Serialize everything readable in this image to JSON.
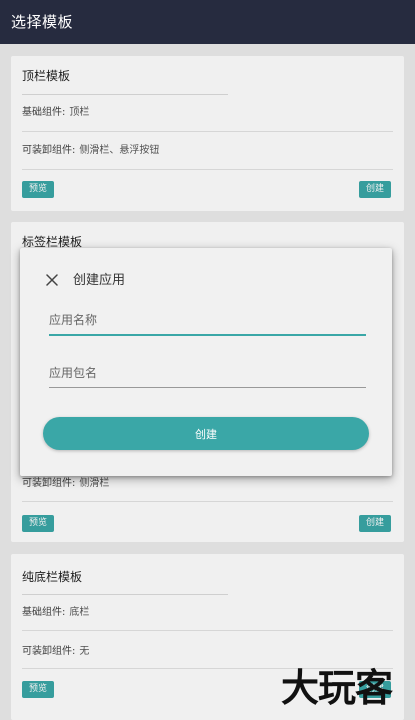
{
  "appbar": {
    "title": "选择模板"
  },
  "cards": [
    {
      "title": "顶栏模板",
      "rows": [
        {
          "label": "基础组件:",
          "value": "顶栏"
        },
        {
          "label": "可装卸组件:",
          "value": "侧滑栏、悬浮按钮"
        }
      ],
      "preview_label": "预览",
      "create_label": "创建"
    },
    {
      "title": "标签栏模板",
      "rows": [
        {
          "label": "可装卸组件:",
          "value": "侧滑栏"
        }
      ],
      "preview_label": "预览",
      "create_label": "创建"
    },
    {
      "title": "纯底栏模板",
      "rows": [
        {
          "label": "基础组件:",
          "value": "底栏"
        },
        {
          "label": "可装卸组件:",
          "value": "无"
        }
      ],
      "preview_label": "预览",
      "create_label": "创建"
    }
  ],
  "dialog": {
    "title": "创建应用",
    "app_name_placeholder": "应用名称",
    "package_name_placeholder": "应用包名",
    "create_label": "创建"
  },
  "watermark": "大玩客",
  "colors": {
    "appbar": "#262b3f",
    "accent": "#3aa7a7",
    "background": "#ececec"
  }
}
